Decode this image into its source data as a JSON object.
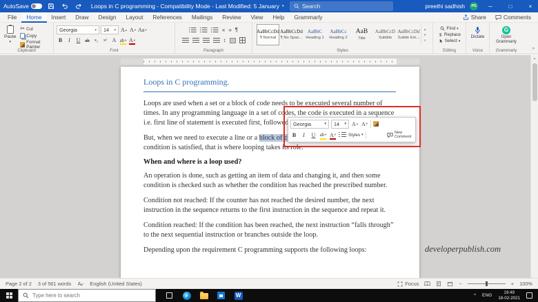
{
  "glyphs": {
    "caret_down": "▾",
    "caret_up": "▴",
    "menu": "≡",
    "scroll_up": "▲",
    "scroll_down": "▼",
    "minimize": "─",
    "maximize": "□",
    "close": "×",
    "pilcrow": "¶",
    "collapse_ribbon": "^",
    "tray_chevron": "^",
    "outdent": "«",
    "indent": "»",
    "updown": "↕",
    "minus": "−",
    "plus": "+",
    "scissors": "✂",
    "edge_logo": "e",
    "word_logo": "W"
  },
  "titlebar": {
    "autosave_label": "AutoSave",
    "document_title": "Loops in C programming  -  Compatibility Mode  -  Last Modified: 5 January",
    "search_placeholder": "Search",
    "user_name": "preethi sadhish",
    "user_initials": "PS"
  },
  "menubar": {
    "tabs": [
      "File",
      "Home",
      "Insert",
      "Draw",
      "Design",
      "Layout",
      "References",
      "Mailings",
      "Review",
      "View",
      "Help",
      "Grammarly"
    ],
    "active_tab": "Home",
    "share_label": "Share",
    "comments_label": "Comments"
  },
  "ribbon": {
    "clipboard": {
      "group_label": "Clipboard",
      "paste_label": "Paste",
      "cut_label": "Cut",
      "copy_label": "Copy",
      "format_painter_label": "Format Painter"
    },
    "font": {
      "group_label": "Font",
      "font_name": "Georgia",
      "font_size": "14",
      "grow": "A",
      "shrink": "A",
      "case": "Aa",
      "bold": "B",
      "italic": "I",
      "underline": "U",
      "strike": "ab",
      "sub": "x₂",
      "sup": "x²",
      "effects": "A",
      "highlight": "ab",
      "color": "A"
    },
    "paragraph": {
      "group_label": "Paragraph"
    },
    "styles": {
      "group_label": "Styles",
      "items": [
        {
          "sample": "AaBbCcDd",
          "name": "¶ Normal"
        },
        {
          "sample": "AaBbCcDd",
          "name": "¶ No Spac..."
        },
        {
          "sample": "AaBbC",
          "name": "Heading 1"
        },
        {
          "sample": "AaBbCc",
          "name": "Heading 2"
        },
        {
          "sample": "AaB",
          "name": "Title"
        },
        {
          "sample": "AaBbCcD",
          "name": "Subtitle"
        },
        {
          "sample": "AaBbCcDd",
          "name": "Subtle Em..."
        }
      ]
    },
    "editing": {
      "group_label": "Editing",
      "find_label": "Find",
      "replace_label": "Replace",
      "select_label": "Select"
    },
    "voice": {
      "group_label": "Voice",
      "dictate_label": "Dictate"
    },
    "grammarly": {
      "group_label": "Grammarly",
      "open_label": "Open Grammarly",
      "initial": "G"
    }
  },
  "mini_toolbar": {
    "font_name": "Georgia",
    "font_size": "14",
    "grow": "A",
    "shrink": "A",
    "bold": "B",
    "italic": "I",
    "underline": "U",
    "highlight": "ab",
    "color": "A",
    "styles_label": "Styles",
    "new_comment_label": "New Comment"
  },
  "document": {
    "title": "Loops in C programming.",
    "para1": "Loops are used when a set or a block of code needs to be executed several number of times. In any programming language in a set of codes, the code is executed in a sequence i.e. first line of statement is executed first, followed by each line of statement.",
    "para2_before": "But, when we need to execute a line or a ",
    "para2_selected": "block of code",
    "para2_after": " for several times until a certain condition is satisfied, that is where looping takes its role.",
    "heading": "When and where is a loop used?",
    "para3": "An operation is done, such as getting an item of data and changing it, and then some condition is checked such as whether the condition has reached the prescribed number.",
    "para4": "Condition not reached: If the counter has not reached the desired number, the next instruction in the sequence returns to the first instruction in the sequence and repeat it.",
    "para5": "Condition reached: If the condition has been reached, the next instruction “falls through” to the next sequential instruction or branches outside the loop.",
    "para6": "Depending upon the requirement C programming supports the following loops:"
  },
  "watermark": "developerpublish.com",
  "statusbar": {
    "page_info": "Page 2 of 2",
    "word_count": "3 of 561 words",
    "language": "English (United States)",
    "focus_label": "Focus",
    "zoom_level": "100%"
  },
  "taskbar": {
    "search_placeholder": "Type here to search",
    "language": "ENG",
    "time": "19:49",
    "date": "18-02-2021"
  }
}
